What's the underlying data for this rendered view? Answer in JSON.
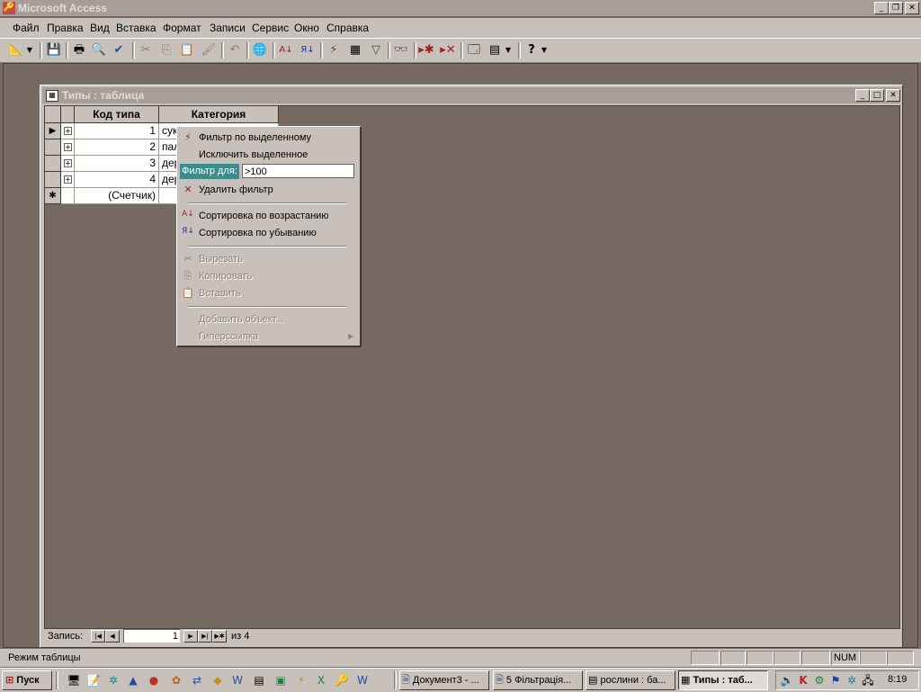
{
  "app": {
    "title": "Microsoft Access"
  },
  "menu": [
    "Файл",
    "Правка",
    "Вид",
    "Вставка",
    "Формат",
    "Записи",
    "Сервис",
    "Окно",
    "Справка"
  ],
  "child": {
    "title": "Типы : таблица"
  },
  "table": {
    "columns": [
      "Код типа",
      "Категория"
    ],
    "rows": [
      {
        "id": "1",
        "cat": "сук"
      },
      {
        "id": "2",
        "cat": "пал"
      },
      {
        "id": "3",
        "cat": "дер"
      },
      {
        "id": "4",
        "cat": "дер"
      }
    ],
    "new_row": "(Счетчик)"
  },
  "context_menu": {
    "filter_selection": "Фильтр по выделенному",
    "exclude_selection": "Исключить выделенное",
    "filter_for_label": "Фильтр для:",
    "filter_for_value": ">100",
    "remove_filter": "Удалить фильтр",
    "sort_asc": "Сортировка по возрастанию",
    "sort_desc": "Сортировка по убыванию",
    "cut": "Вырезать",
    "copy": "Копировать",
    "paste": "Вставить",
    "insert_object": "Добавить объект...",
    "hyperlink": "Гиперссылка"
  },
  "record_nav": {
    "label": "Запись:",
    "current": "1",
    "of": "из 4"
  },
  "status": {
    "text": "Режим таблицы",
    "num": "NUM"
  },
  "taskbar": {
    "start": "Пуск",
    "tasks": [
      "Документ3 - ...",
      "5 Фільтрація...",
      "рослини : ба...",
      "Типы : таб..."
    ],
    "clock": "8:19"
  }
}
